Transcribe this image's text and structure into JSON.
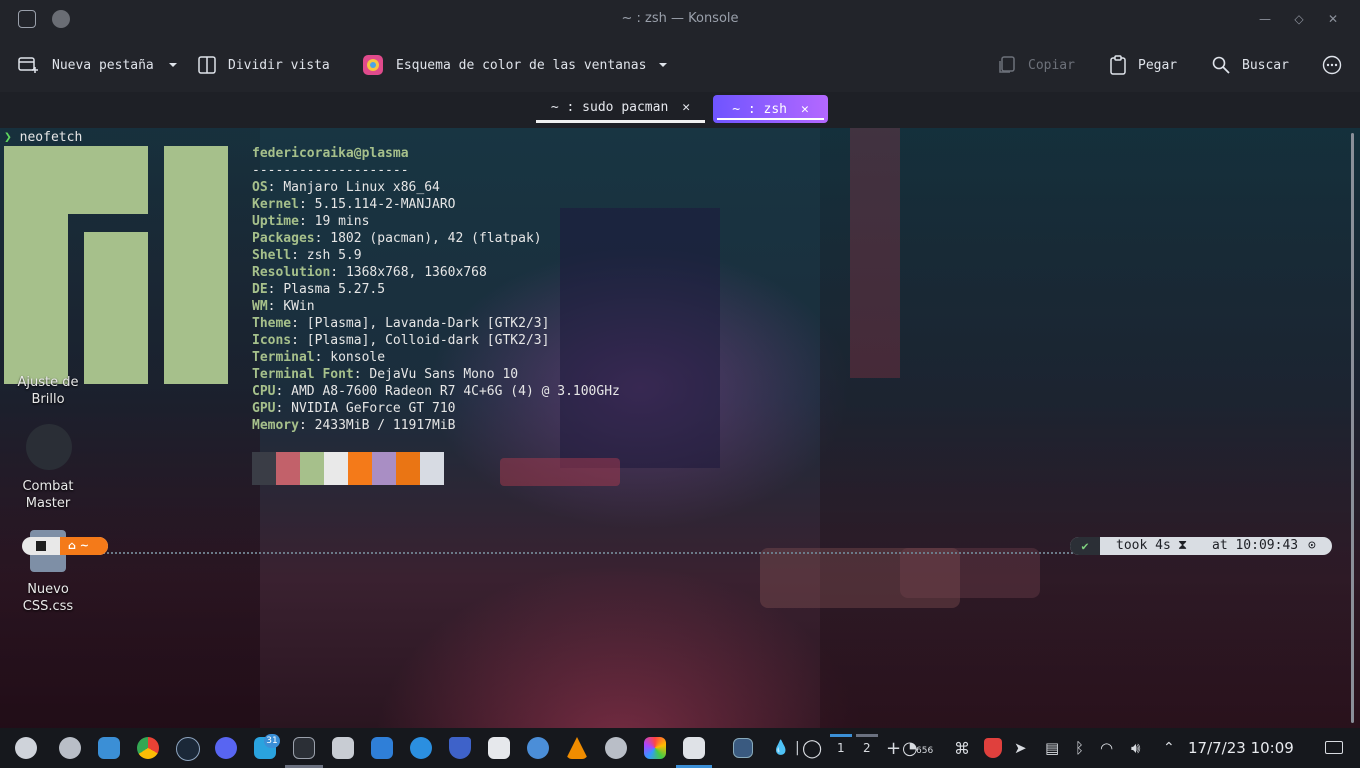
{
  "window": {
    "title": "~ : zsh — Konsole"
  },
  "toolbar": {
    "new_tab": "Nueva pestaña",
    "split_view": "Dividir vista",
    "color_scheme": "Esquema de color de las ventanas",
    "copy": "Copiar",
    "paste": "Pegar",
    "find": "Buscar"
  },
  "tabs": [
    {
      "label": "~ : sudo pacman",
      "active": false
    },
    {
      "label": "~ : zsh",
      "active": true
    }
  ],
  "terminal": {
    "command": "neofetch",
    "user_host": "federicoraika@plasma",
    "separator": "--------------------",
    "info": [
      {
        "key": "OS",
        "value": "Manjaro Linux x86_64"
      },
      {
        "key": "Kernel",
        "value": "5.15.114-2-MANJARO"
      },
      {
        "key": "Uptime",
        "value": "19 mins"
      },
      {
        "key": "Packages",
        "value": "1802 (pacman), 42 (flatpak)"
      },
      {
        "key": "Shell",
        "value": "zsh 5.9"
      },
      {
        "key": "Resolution",
        "value": "1368x768, 1360x768"
      },
      {
        "key": "DE",
        "value": "Plasma 5.27.5"
      },
      {
        "key": "WM",
        "value": "KWin"
      },
      {
        "key": "Theme",
        "value": "[Plasma], Lavanda-Dark [GTK2/3]"
      },
      {
        "key": "Icons",
        "value": "[Plasma], Colloid-dark [GTK2/3]"
      },
      {
        "key": "Terminal",
        "value": "konsole"
      },
      {
        "key": "Terminal Font",
        "value": "DejaVu Sans Mono 10"
      },
      {
        "key": "CPU",
        "value": "AMD A8-7600 Radeon R7 4C+6G (4) @ 3.100GHz"
      },
      {
        "key": "GPU",
        "value": "NVIDIA GeForce GT 710"
      },
      {
        "key": "Memory",
        "value": "2433MiB / 11917MiB"
      }
    ],
    "swatches": [
      "#3a3d46",
      "#c2616a",
      "#a6c08b",
      "#e9e9e9",
      "#f47a19",
      "#a98ec4",
      "#ea7514",
      "#d7dbe3"
    ],
    "prompt_home": "~",
    "took": "took 4s",
    "at_time": "at 10:09:43"
  },
  "desktop_icons": [
    {
      "label": "Ajuste de Brillo"
    },
    {
      "label": "Combat Master"
    },
    {
      "label": "Nuevo CSS.css"
    }
  ],
  "taskbar": {
    "badge": "31",
    "desktop_1": "1",
    "desktop_2": "2",
    "meter": "656",
    "clock": "17/7/23 10:09"
  }
}
